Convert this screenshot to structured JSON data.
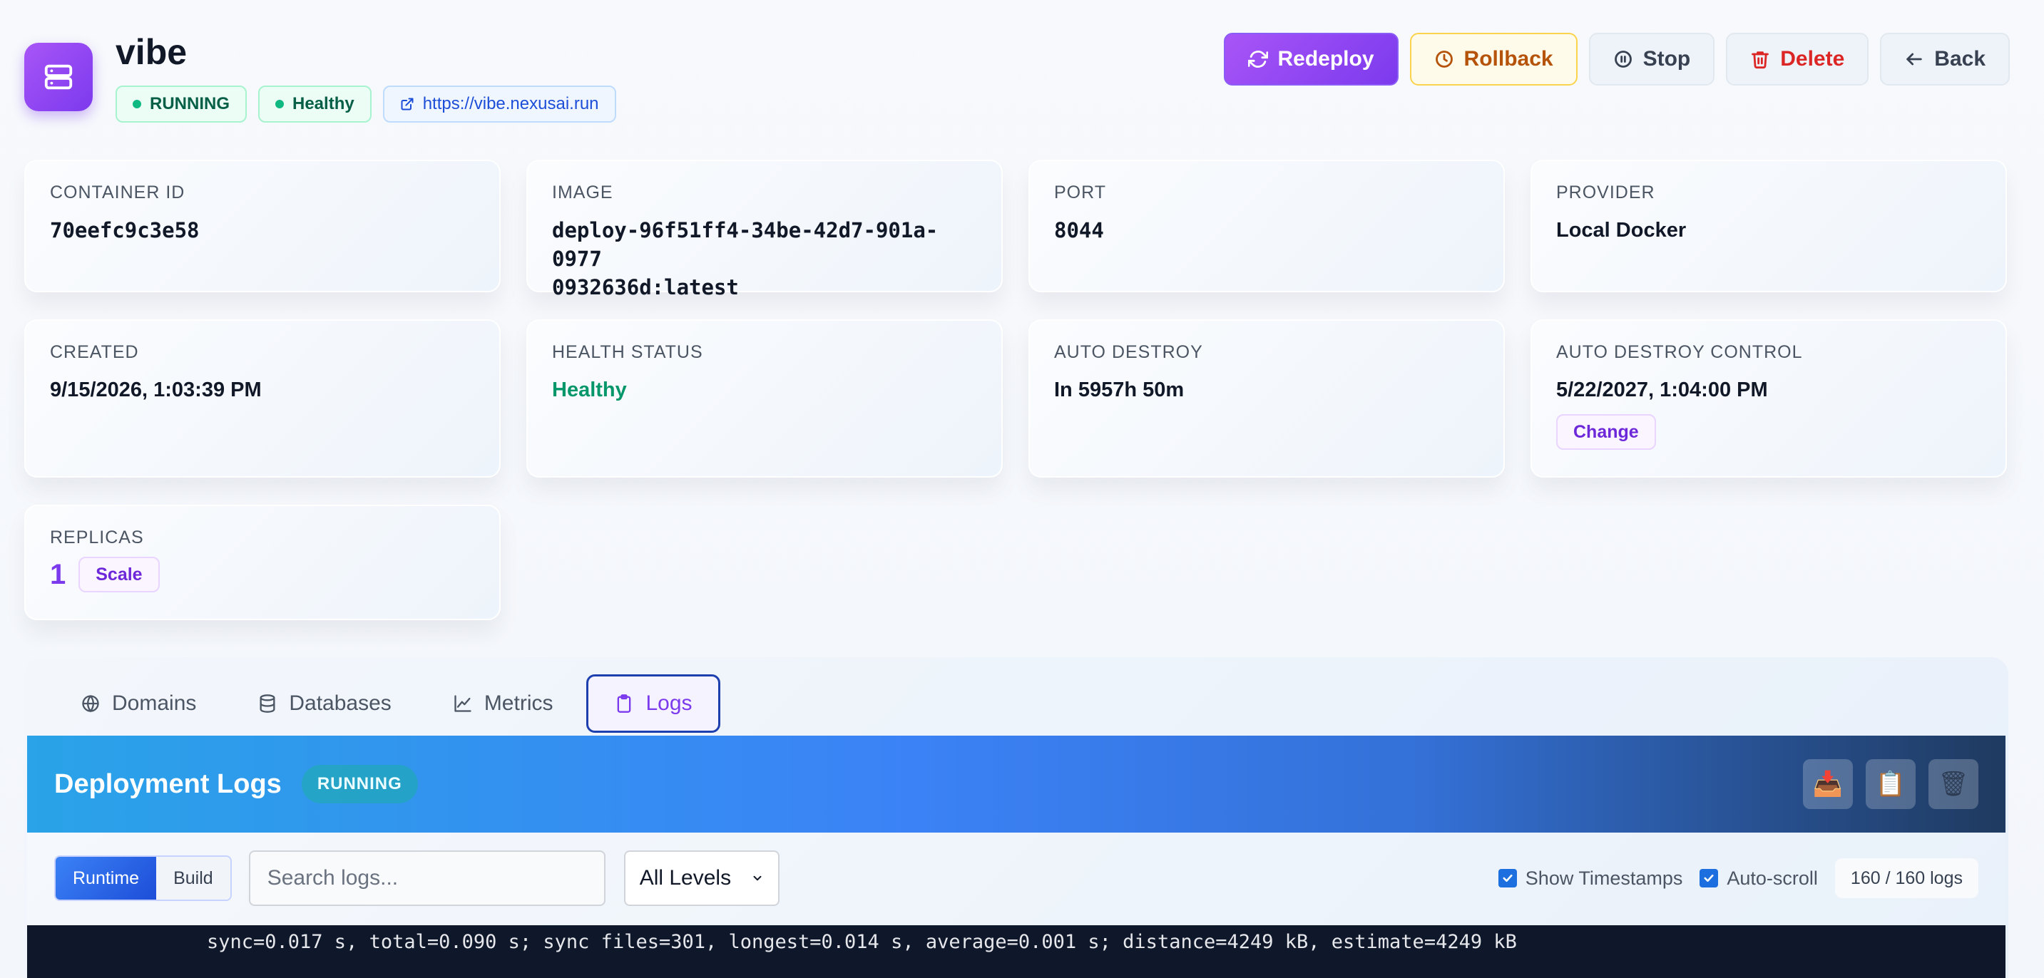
{
  "app": {
    "name": "vibe",
    "icon": "server-icon",
    "status": "RUNNING",
    "health": "Healthy",
    "url": "https://vibe.nexusai.run"
  },
  "actions": {
    "redeploy": "Redeploy",
    "rollback": "Rollback",
    "stop": "Stop",
    "delete": "Delete",
    "back": "Back"
  },
  "cards": {
    "container_id": {
      "label": "CONTAINER ID",
      "value": "70eefc9c3e58"
    },
    "image": {
      "label": "IMAGE",
      "value_line1": "deploy-96f51ff4-34be-42d7-901a-0977",
      "value_line2": "0932636d:latest"
    },
    "port": {
      "label": "PORT",
      "value": "8044"
    },
    "provider": {
      "label": "PROVIDER",
      "value": "Local Docker"
    },
    "created": {
      "label": "CREATED",
      "value": "9/15/2026, 1:03:39 PM"
    },
    "health_status": {
      "label": "HEALTH STATUS",
      "value": "Healthy"
    },
    "auto_destroy": {
      "label": "AUTO DESTROY",
      "value": "In 5957h 50m"
    },
    "auto_destroy_control": {
      "label": "AUTO DESTROY CONTROL",
      "value": "5/22/2027, 1:04:00 PM",
      "button": "Change"
    },
    "replicas": {
      "label": "REPLICAS",
      "value": "1",
      "button": "Scale"
    }
  },
  "tabs": [
    {
      "label": "Domains",
      "icon": "globe-icon"
    },
    {
      "label": "Databases",
      "icon": "database-icon"
    },
    {
      "label": "Metrics",
      "icon": "chart-icon"
    },
    {
      "label": "Logs",
      "icon": "clipboard-icon",
      "active": true
    }
  ],
  "logs": {
    "title": "Deployment Logs",
    "status": "RUNNING",
    "header_icons": [
      "download-icon",
      "copy-icon",
      "trash-icon"
    ],
    "source_runtime": "Runtime",
    "source_build": "Build",
    "search_placeholder": "Search logs...",
    "level": "All Levels",
    "show_timestamps": "Show Timestamps",
    "auto_scroll": "Auto-scroll",
    "count": "160 / 160 logs",
    "lines": [
      "sync=0.017 s, total=0.090 s; sync files=301, longest=0.014 s, average=0.001 s; distance=4249 kB, estimate=4249 kB"
    ]
  },
  "colors": {
    "accent": "#7c3aed",
    "success": "#10b981",
    "danger": "#dc2626",
    "warning": "#b45309",
    "log_bg": "#0f172a"
  }
}
